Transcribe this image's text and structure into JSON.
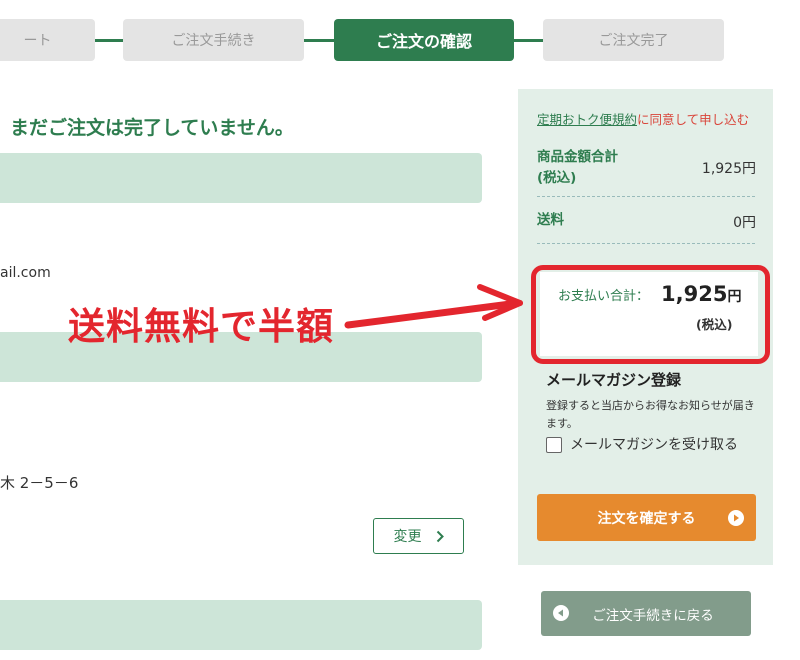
{
  "steps": [
    {
      "label": "ート",
      "active": false
    },
    {
      "label": "ご注文手続き",
      "active": false
    },
    {
      "label": "ご注文の確認",
      "active": true
    },
    {
      "label": "ご注文完了",
      "active": false
    }
  ],
  "notice": "まだご注文は完了していません。",
  "email_fragment": "ail.com",
  "address_fragment": "木 2－5－6",
  "change_button": "変更",
  "summary": {
    "agree_link": "定期おトク便規約",
    "agree_rest": "に同意して申し込む",
    "subtotal_label": "商品金額合計(税込)",
    "subtotal_value": "1,925円",
    "shipping_label": "送料",
    "shipping_value": "0円",
    "total_label": "お支払い合計：",
    "total_amount": "1,925",
    "total_unit": "円",
    "total_tax": "(税込)"
  },
  "magazine": {
    "title": "メールマガジン登録",
    "desc": "登録すると当店からお得なお知らせが届きます。",
    "checkbox_label": "メールマガジンを受け取る"
  },
  "confirm_button": "注文を確定する",
  "back_button": "ご注文手続きに戻る",
  "annotation": "送料無料で半額",
  "colors": {
    "brand_green": "#2e7d4f",
    "accent_orange": "#e68a2e",
    "annotation_red": "#e3262e"
  }
}
